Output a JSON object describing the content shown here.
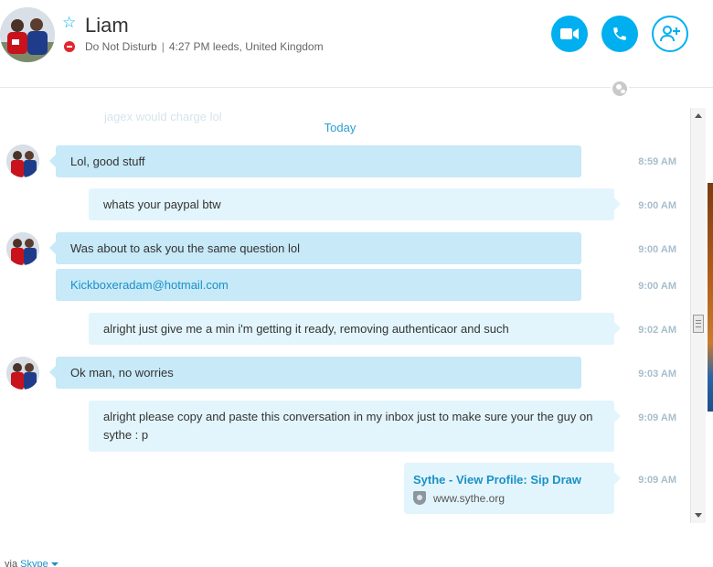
{
  "contact": {
    "name": "Liam",
    "status": "Do Not Disturb",
    "separator": "|",
    "local_time": "4:27 PM leeds, United Kingdom"
  },
  "header_actions": {
    "video_call": "video-camera-icon",
    "voice_call": "phone-icon",
    "add_contact": "add-person-icon"
  },
  "chat": {
    "faded_previous": "jagex would charge lol",
    "date_separator": "Today",
    "messages": [
      {
        "direction": "in",
        "text": "Lol, good stuff",
        "time": "8:59 AM",
        "avatar": true
      },
      {
        "direction": "out",
        "text": "whats your paypal btw",
        "time": "9:00 AM"
      },
      {
        "direction": "in",
        "text": "Was about to ask you the same question lol",
        "time": "9:00 AM",
        "avatar": true
      },
      {
        "direction": "in",
        "text": "Kickboxeradam@hotmail.com",
        "time": "9:00 AM",
        "is_link": true
      },
      {
        "direction": "out",
        "text": "alright just give me a min i'm getting it ready, removing authenticaor and such",
        "time": "9:02 AM"
      },
      {
        "direction": "in",
        "text": "Ok man, no worries",
        "time": "9:03 AM",
        "avatar": true
      },
      {
        "direction": "out",
        "text": "alright please copy and paste this conversation in my inbox just to make sure your the guy on sythe : p",
        "time": "9:09 AM"
      }
    ],
    "link_preview": {
      "title": "Sythe - View Profile: Sip Draw",
      "domain": "www.sythe.org",
      "time": "9:09 AM"
    }
  },
  "footer": {
    "via": "via",
    "service": "Skype"
  },
  "colors": {
    "accent": "#00aff0",
    "incoming_bubble": "#c7e9f8",
    "outgoing_bubble": "#e3f5fc",
    "dnd_red": "#e0262e",
    "timestamp": "#a6bfcc"
  }
}
